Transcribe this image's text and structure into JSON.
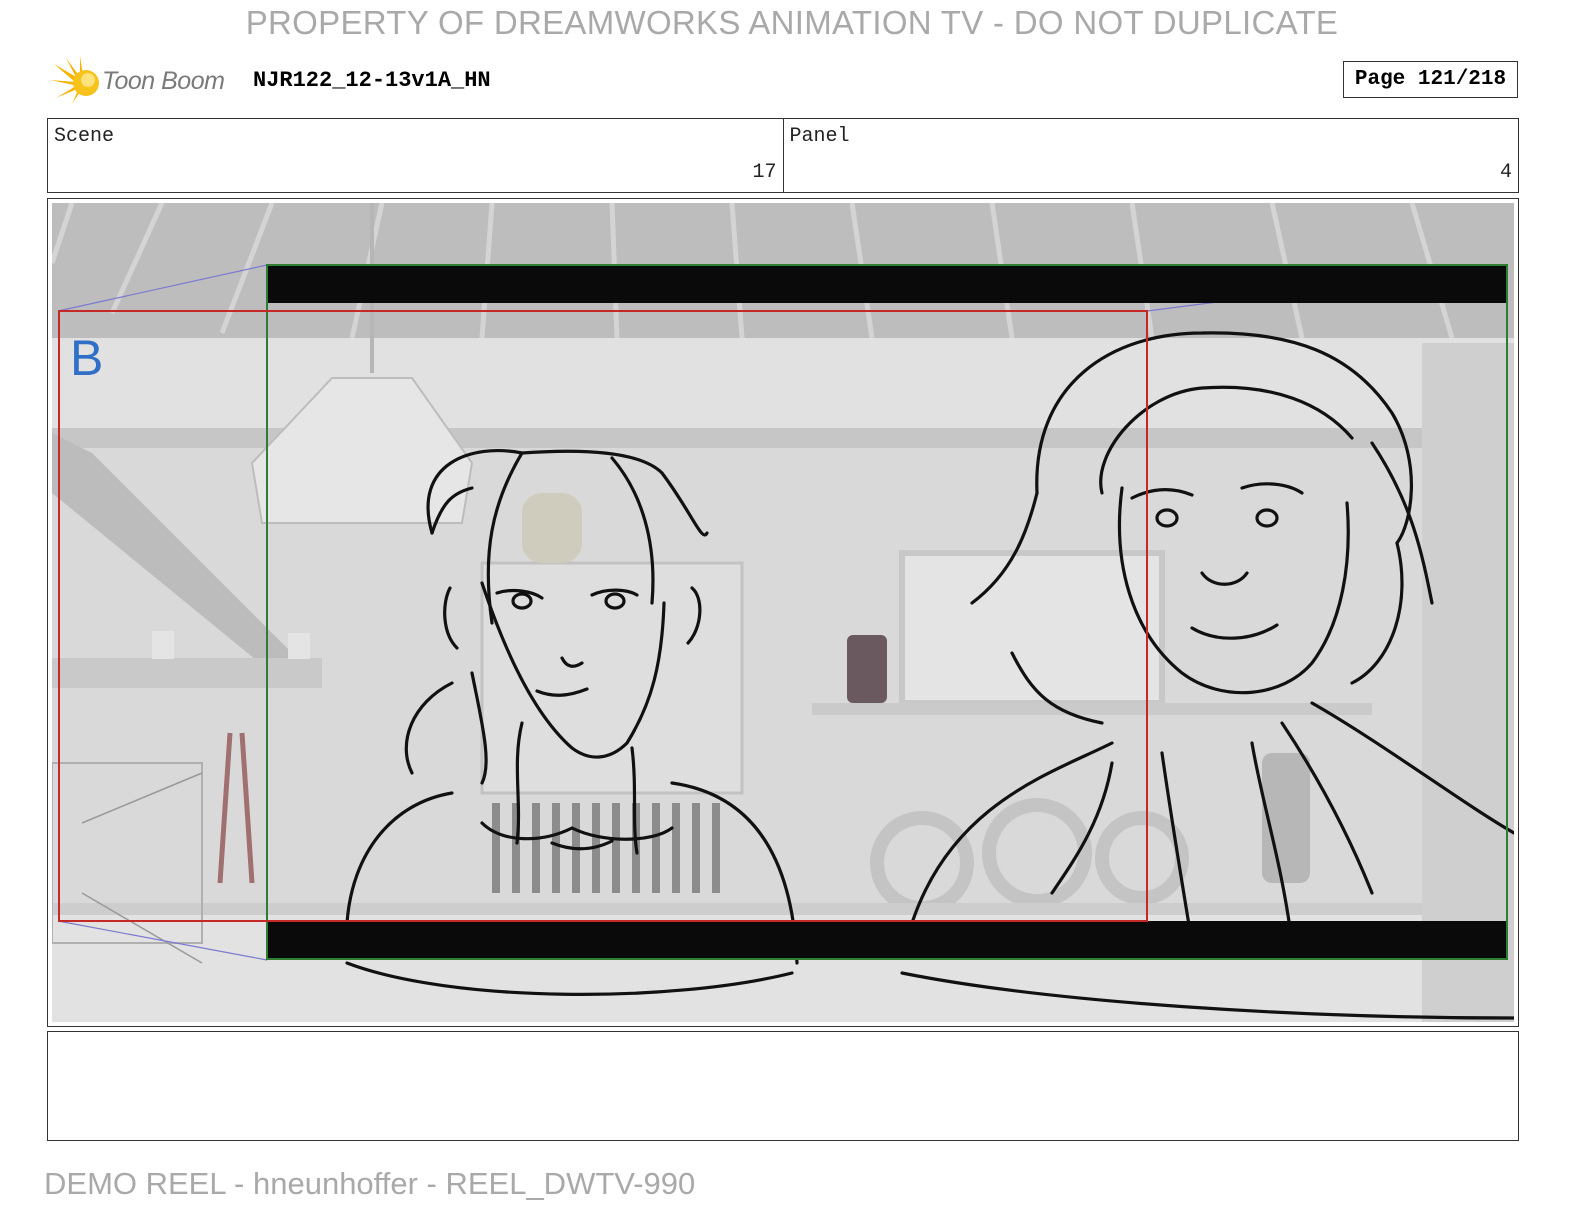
{
  "watermark": {
    "top": "PROPERTY OF DREAMWORKS ANIMATION TV - DO NOT DUPLICATE",
    "bottom": "DEMO REEL - hneunhoffer - REEL_DWTV-990"
  },
  "header": {
    "logo_text": "Toon Boom",
    "project_name": "NJR122_12-13v1A_HN",
    "page": "Page 121/218"
  },
  "info": {
    "scene_label": "Scene",
    "scene_value": "17",
    "panel_label": "Panel",
    "panel_value": "4"
  },
  "panel": {
    "layer_marker": "B",
    "frame_colors": {
      "camera_field": "#2e7d32",
      "layer_field": "#c62828",
      "marker": "#2f6fc6",
      "letterbox": "#0a0a0a"
    }
  },
  "notes": {
    "text": ""
  }
}
